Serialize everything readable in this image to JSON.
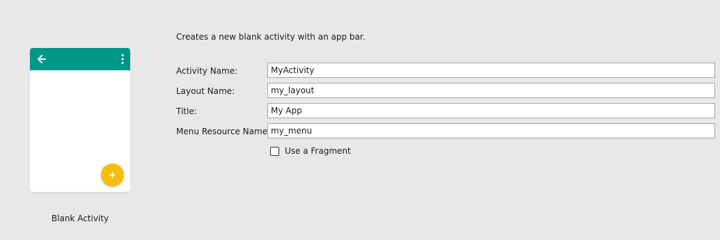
{
  "template_preview": {
    "caption": "Blank Activity",
    "appbar_color": "#009688",
    "fab_color": "#f5be0b",
    "icons": {
      "back": "arrow-back-icon",
      "overflow": "more-vert-icon",
      "fab": "plus-icon"
    }
  },
  "description": "Creates a new blank activity with an app bar.",
  "fields": {
    "activity_name": {
      "label": "Activity Name:",
      "value": "MyActivity"
    },
    "layout_name": {
      "label": "Layout Name:",
      "value": "my_layout"
    },
    "title": {
      "label": "Title:",
      "value": "My App"
    },
    "menu_resource_name": {
      "label": "Menu Resource Name:",
      "value": "my_menu"
    }
  },
  "use_fragment": {
    "label": "Use a Fragment",
    "checked": false
  }
}
